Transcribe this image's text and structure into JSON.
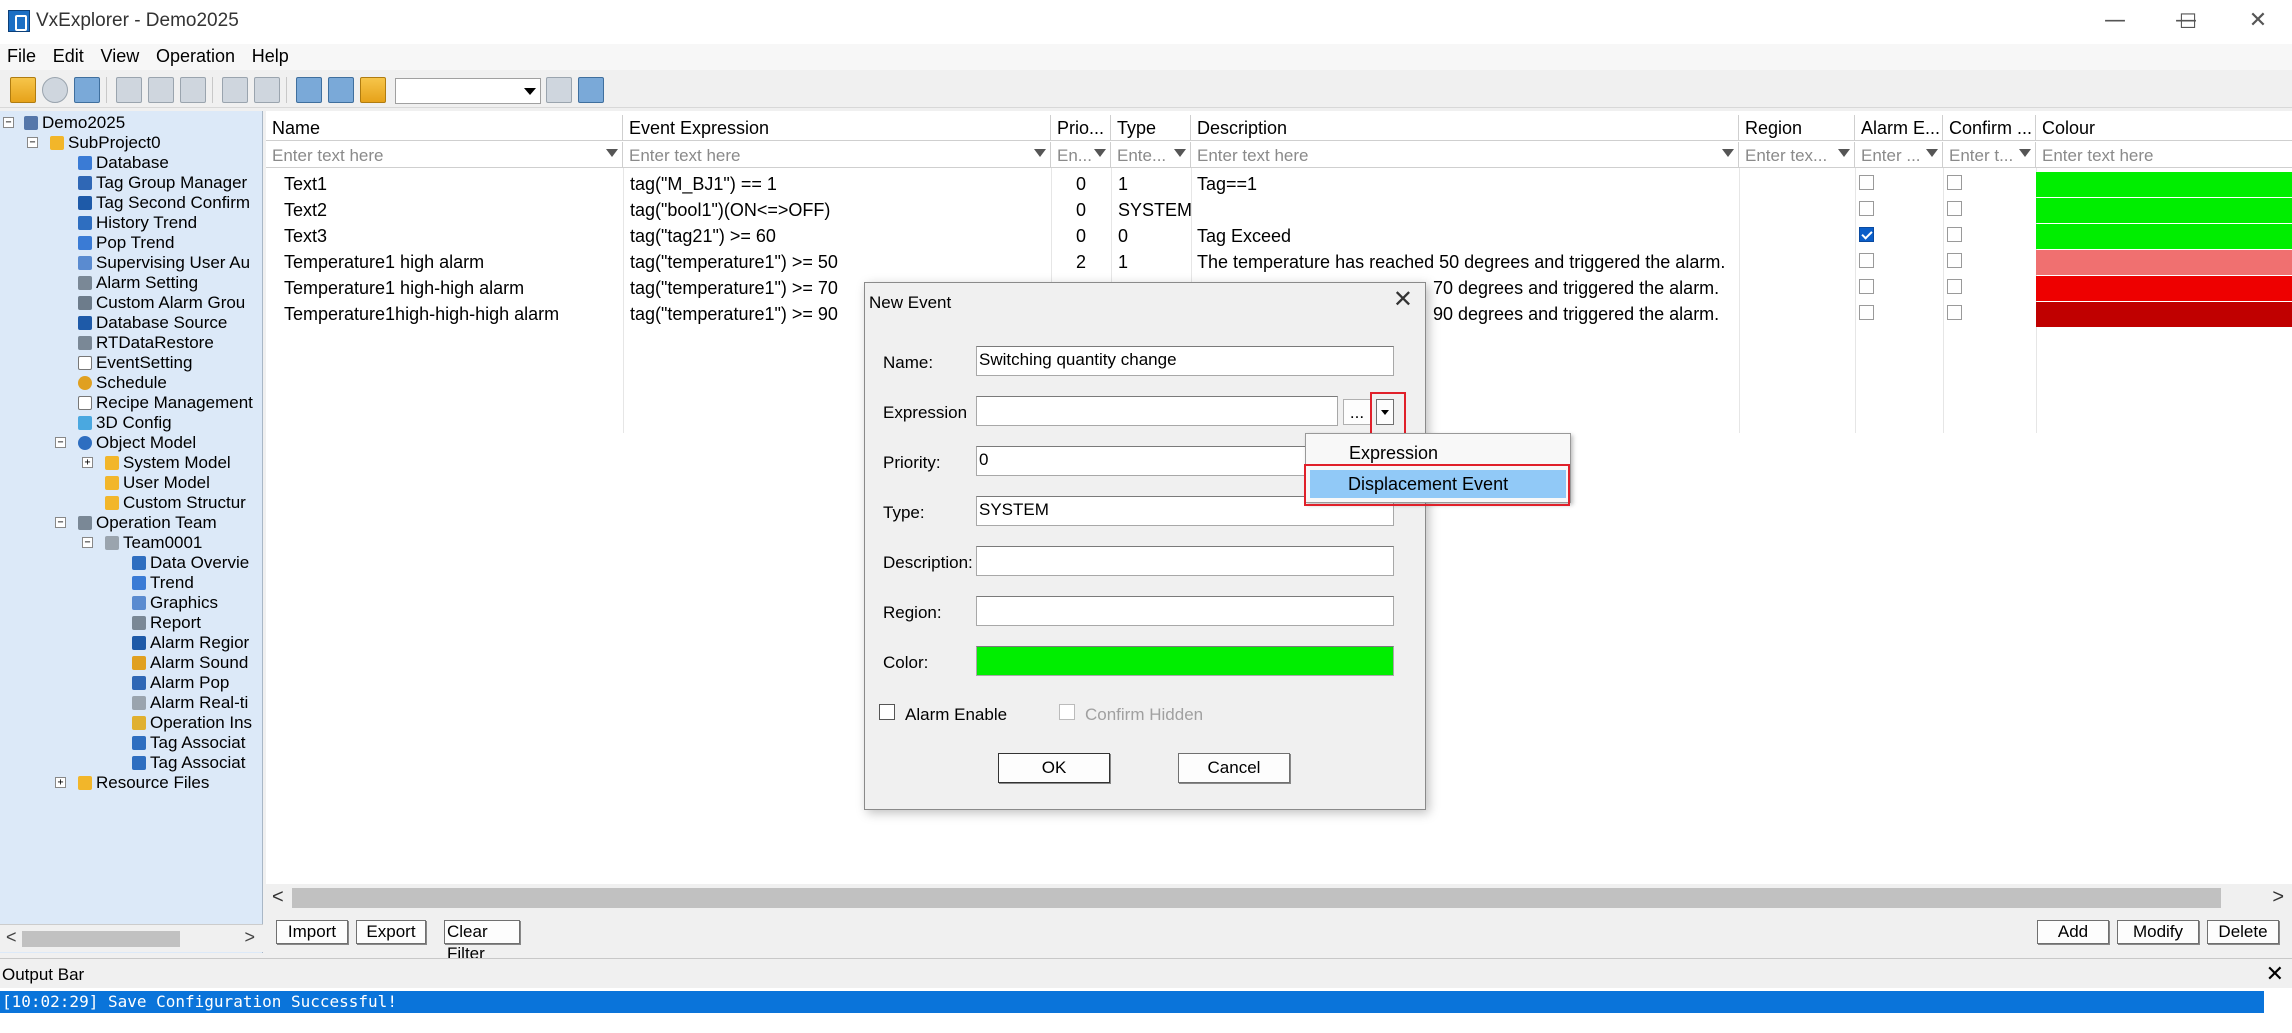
{
  "window": {
    "title": "VxExplorer - Demo2025"
  },
  "window_controls": {
    "minimize": "—",
    "maximize": "☐",
    "close": "✕"
  },
  "menu": [
    "File",
    "Edit",
    "View",
    "Operation",
    "Help"
  ],
  "tree": {
    "items": [
      "Demo2025",
      "SubProject0",
      "Database",
      "Tag Group Manager",
      "Tag Second Confirm",
      "History Trend",
      "Pop Trend",
      "Supervising User Au",
      "Alarm Setting",
      "Custom Alarm Grou",
      "Database Source",
      "RTDataRestore",
      "EventSetting",
      "Schedule",
      "Recipe Management",
      "3D Config",
      "Object Model",
      "System Model",
      "User Model",
      "Custom Structur",
      "Operation Team",
      "Team0001",
      "Data Overvie",
      "Trend",
      "Graphics",
      "Report",
      "Alarm Regior",
      "Alarm Sound",
      "Alarm Pop",
      "Alarm Real-ti",
      "Operation Ins",
      "Tag Associat",
      "Tag Associat",
      "Resource Files"
    ]
  },
  "grid": {
    "columns": [
      "Name",
      "Event Expression",
      "Prio...",
      "Type",
      "Description",
      "Region",
      "Alarm E...",
      "Confirm ...",
      "Colour"
    ],
    "filters": [
      "Enter text here",
      "Enter text here",
      "En...",
      "Ente...",
      "Enter text here",
      "Enter tex...",
      "Enter ...",
      "Enter t...",
      "Enter text here"
    ],
    "rows": [
      {
        "name": "Text1",
        "expr": "tag(\"M_BJ1\") == 1",
        "prio": "0",
        "type": "1",
        "desc": "Tag==1",
        "alarm": false,
        "confirm": false,
        "colour": "#00ee00"
      },
      {
        "name": "Text2",
        "expr": "tag(\"bool1\")(ON<=>OFF)",
        "prio": "0",
        "type": "SYSTEM",
        "desc": "",
        "alarm": false,
        "confirm": false,
        "colour": "#00ee00"
      },
      {
        "name": "Text3",
        "expr": "tag(\"tag21\") >= 60",
        "prio": "0",
        "type": "0",
        "desc": "Tag Exceed",
        "alarm": true,
        "confirm": false,
        "colour": "#00ee00"
      },
      {
        "name": "Temperature1 high alarm",
        "expr": "tag(\"temperature1\") >= 50",
        "prio": "2",
        "type": "1",
        "desc": "The temperature has reached 50 degrees and triggered the alarm.",
        "alarm": false,
        "confirm": false,
        "colour": "#f07070"
      },
      {
        "name": "Temperature1 high-high alarm",
        "expr": "tag(\"temperature1\") >= 70",
        "prio": "",
        "type": "",
        "desc": "70 degrees and triggered the alarm.",
        "alarm": false,
        "confirm": false,
        "colour": "#ee0000"
      },
      {
        "name": "Temperature1high-high-high alarm",
        "expr": "tag(\"temperature1\") >= 90",
        "prio": "",
        "type": "",
        "desc": "90 degrees and triggered the alarm.",
        "alarm": false,
        "confirm": false,
        "colour": "#c00000"
      }
    ]
  },
  "buttons": {
    "import": "Import",
    "export": "Export",
    "clear_filter": "Clear Filter",
    "add": "Add",
    "modify": "Modify",
    "delete": "Delete"
  },
  "output_bar": {
    "title": "Output Bar",
    "message": "[10:02:29] Save Configuration Successful!"
  },
  "dialog": {
    "title": "New Event",
    "labels": {
      "name": "Name:",
      "expression": "Expression",
      "priority": "Priority:",
      "type": "Type:",
      "description": "Description:",
      "region": "Region:",
      "color": "Color:"
    },
    "values": {
      "name": "Switching quantity change",
      "expression": "",
      "priority": "0",
      "type": "SYSTEM",
      "description": "",
      "region": "",
      "color": "#00ee00"
    },
    "ellipsis": "...",
    "alarm_enable": "Alarm Enable",
    "confirm_hidden": "Confirm Hidden",
    "ok": "OK",
    "cancel": "Cancel"
  },
  "dropdown": {
    "items": [
      "Expression",
      "Displacement Event"
    ],
    "selected": "Displacement Event"
  },
  "colors": {
    "highlight": "#e0202a",
    "selection": "#91c9f7",
    "tree_bg": "#dce9f8",
    "status": "#0a74da"
  }
}
